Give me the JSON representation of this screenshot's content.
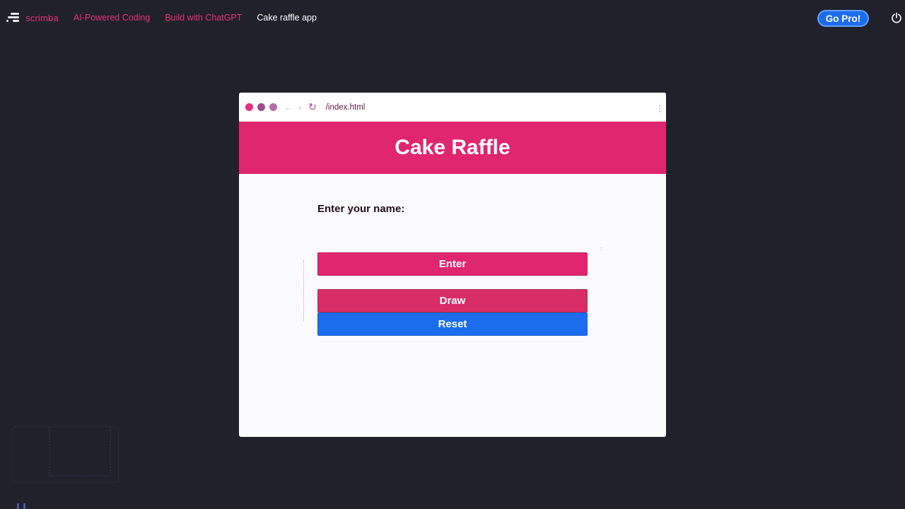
{
  "topbar": {
    "logo_text": "scrimba",
    "breadcrumbs": [
      "AI-Powered Coding",
      "Build with ChatGPT",
      "Cake raffle app"
    ],
    "gopro_label": "Go Pro!",
    "power_icon": "power-icon"
  },
  "browser": {
    "url": "/index.html",
    "icons": [
      "back-icon",
      "forward-icon",
      "reload-icon",
      "menu-icon"
    ]
  },
  "app": {
    "title": "Cake Raffle",
    "prompt_label": "Enter your name:",
    "enter_label": "Enter",
    "draw_label": "Draw",
    "reset_label": "Reset"
  },
  "colors": {
    "accent": "#e0266f",
    "primary_blue": "#1b6ded",
    "background": "#20212a"
  }
}
